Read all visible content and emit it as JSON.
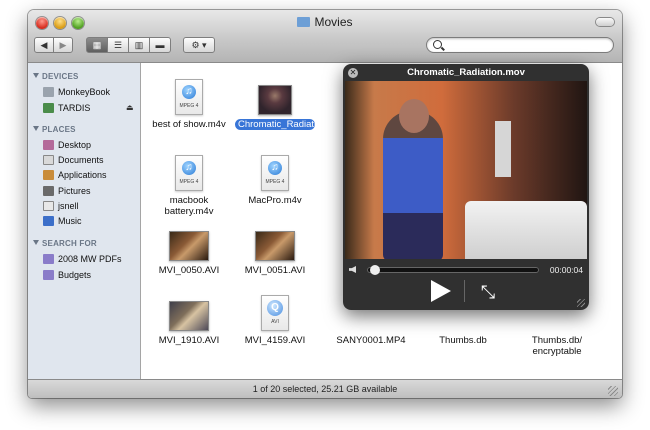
{
  "window": {
    "title": "Movies"
  },
  "toolbar": {
    "back_label": "◀",
    "forward_label": "▶",
    "view_icon_label": "▦",
    "view_list_label": "☰",
    "view_column_label": "▥",
    "view_coverflow_label": "▬",
    "action_label": "⚙ ▾",
    "search_placeholder": ""
  },
  "sidebar": {
    "devices_header": "DEVICES",
    "places_header": "PLACES",
    "search_header": "SEARCH FOR",
    "devices": [
      {
        "label": "MonkeyBook",
        "icon": "laptop-icon"
      },
      {
        "label": "TARDIS",
        "icon": "drive-icon"
      }
    ],
    "places": [
      {
        "label": "Desktop",
        "icon": "desktop-icon"
      },
      {
        "label": "Documents",
        "icon": "documents-icon"
      },
      {
        "label": "Applications",
        "icon": "applications-icon"
      },
      {
        "label": "Pictures",
        "icon": "pictures-icon"
      },
      {
        "label": "jsnell",
        "icon": "home-icon"
      },
      {
        "label": "Music",
        "icon": "music-icon"
      }
    ],
    "search": [
      {
        "label": "2008 MW PDFs",
        "icon": "smart-folder-icon"
      },
      {
        "label": "Budgets",
        "icon": "smart-folder-icon"
      }
    ]
  },
  "files": [
    {
      "label": "best of show.m4v",
      "tag": "MPEG 4"
    },
    {
      "label": "Chromatic_Radiation.mov"
    },
    {
      "label": "macbook battery.m4v",
      "tag": "MPEG 4"
    },
    {
      "label": "MacPro.m4v",
      "tag": "MPEG 4"
    },
    {
      "label": "MVI_0050.AVI"
    },
    {
      "label": "MVI_0051.AVI"
    },
    {
      "label": "MVI_1910.AVI"
    },
    {
      "label": "MVI_4159.AVI",
      "tag": "AVI"
    },
    {
      "label": "SANY0001.MP4"
    },
    {
      "label": "Thumbs.db"
    },
    {
      "label": "Thumbs.db/ encryptable"
    }
  ],
  "partial_labels": {
    "p4": "p4",
    "pg": "PG"
  },
  "status": {
    "text": "1 of 20 selected, 25.21 GB available"
  },
  "quicklook": {
    "title": "Chromatic_Radiation.mov",
    "time": "00:00:04",
    "close_label": "✕",
    "fullscreen_label": "⤡",
    "progress": 0.02
  }
}
